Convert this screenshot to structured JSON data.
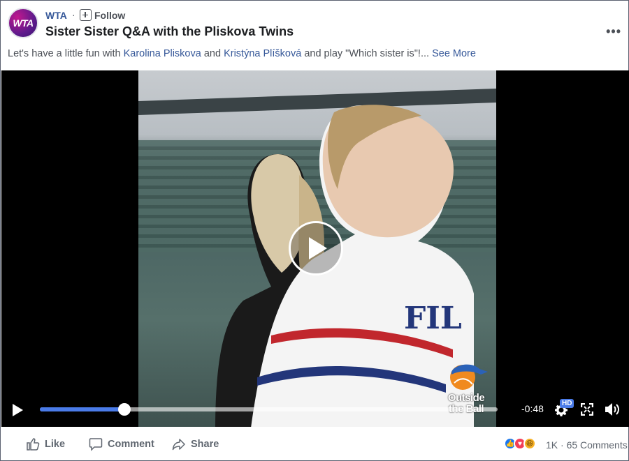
{
  "post": {
    "page_name": "WTA",
    "avatar_text": "WTA",
    "separator": "·",
    "follow_label": "Follow",
    "title": "Sister Sister Q&A with the Pliskova Twins",
    "more_label": "•••",
    "caption": {
      "prefix": "Let's have a little fun with ",
      "mention1": "Karolina Pliskova",
      "middle": " and ",
      "mention2": "Kristýna Plíšková",
      "suffix": " and play \"Which sister is\"!... ",
      "see_more": "See More"
    }
  },
  "video": {
    "watermark_line1": "Outside",
    "watermark_line2": "the Ball",
    "time_remaining": "-0:48",
    "progress": 0.185,
    "quality_badge": "HD",
    "accent_color": "#4a7be8"
  },
  "footer": {
    "like_label": "Like",
    "comment_label": "Comment",
    "share_label": "Share",
    "reaction_count": "1K",
    "separator": "·",
    "comments_count": "65 Comments"
  }
}
